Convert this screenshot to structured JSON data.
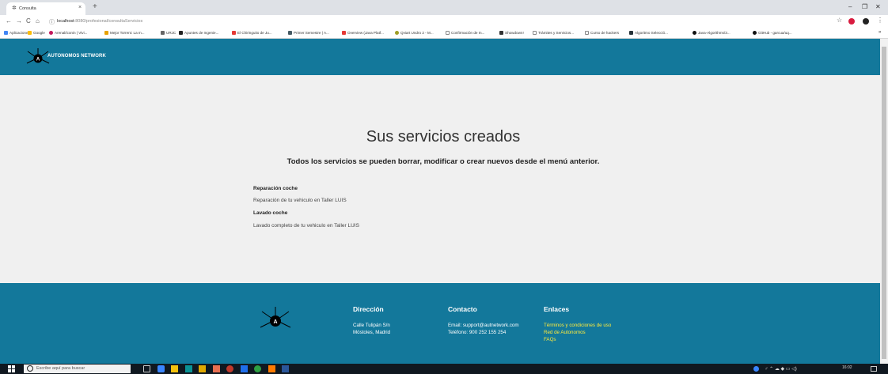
{
  "browser": {
    "tab_title": "Consulta",
    "url_host": "localhost",
    "url_path": ":8080/profesional/consultaServicios",
    "bookmarks": [
      "Aplicaciones",
      "Google",
      "Arenal/iconin | Vivi...",
      "Mejor Torrent: La m...",
      "URJC",
      "Apuntes de Ingenie...",
      "El Chiringuito de Ju...",
      "Primer Semestre | A...",
      "Overview (Java Platf...",
      "Qviart Undro 2 - M...",
      "Confirmación de In...",
      "Showdown!",
      "Trámites y Servicios...",
      "Curso de hackers",
      "Algoritmo Selecció...",
      "Java-Algorithms/3...",
      "GitHub - garcua/uq..."
    ]
  },
  "header": {
    "brand": "AUTONOMOS NETWORK"
  },
  "main": {
    "title": "Sus servicios creados",
    "subtitle": "Todos los servicios se pueden borrar, modificar o crear nuevos desde el menú anterior.",
    "services": [
      {
        "name": "Reparación coche",
        "description": "Reparación de tu vehiculo en Taller LUIS"
      },
      {
        "name": "Lavado coche",
        "description": "Lavado completo de tu vehiculo en Taller LUIS"
      }
    ]
  },
  "footer": {
    "address": {
      "heading": "Dirección",
      "line1": "Calle Tulipán S/n",
      "line2": "Móstoles, Madrid"
    },
    "contact": {
      "heading": "Contacto",
      "email": "Email: support@autnetwork.com",
      "phone": "Teléfono: 900 252 155 254"
    },
    "links": {
      "heading": "Enlaces",
      "items": [
        "Términos y condiciones de uso",
        "Red de Autonomos",
        "FAQs"
      ]
    }
  },
  "taskbar": {
    "search_placeholder": "Escribe aquí para buscar",
    "clock": "16:02"
  },
  "colors": {
    "brand_blue": "#13789b",
    "link_yellow": "#ffeb3b",
    "page_bg": "#f0f0f0"
  }
}
